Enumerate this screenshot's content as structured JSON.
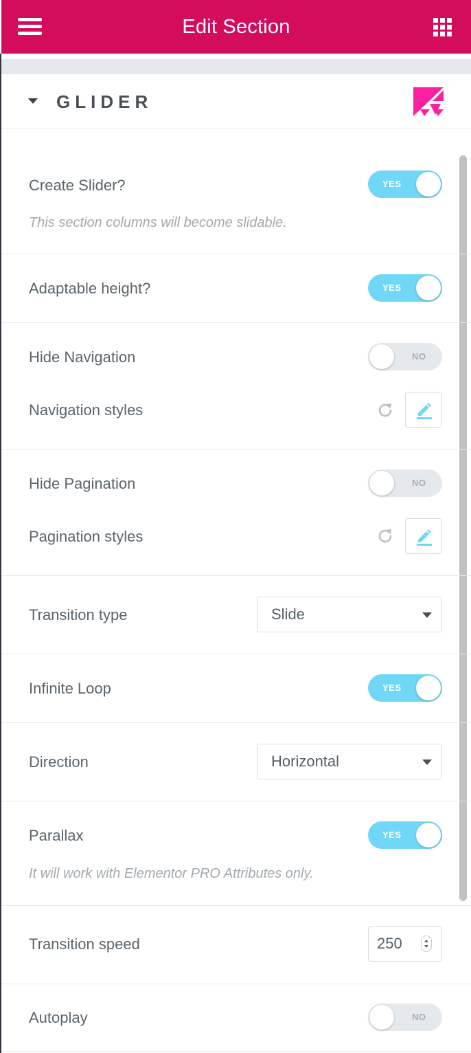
{
  "header": {
    "title": "Edit Section"
  },
  "section": {
    "title": "GLIDER"
  },
  "controls": {
    "create_slider": {
      "label": "Create Slider?",
      "state": "YES",
      "description": "This section columns will become slidable."
    },
    "adaptable_height": {
      "label": "Adaptable height?",
      "state": "YES"
    },
    "hide_navigation": {
      "label": "Hide Navigation",
      "state": "NO"
    },
    "navigation_styles": {
      "label": "Navigation styles"
    },
    "hide_pagination": {
      "label": "Hide Pagination",
      "state": "NO"
    },
    "pagination_styles": {
      "label": "Pagination styles"
    },
    "transition_type": {
      "label": "Transition type",
      "value": "Slide"
    },
    "infinite_loop": {
      "label": "Infinite Loop",
      "state": "YES"
    },
    "direction": {
      "label": "Direction",
      "value": "Horizontal"
    },
    "parallax": {
      "label": "Parallax",
      "state": "YES",
      "description": "It will work with Elementor PRO Attributes only."
    },
    "transition_speed": {
      "label": "Transition speed",
      "value": "250"
    },
    "autoplay": {
      "label": "Autoplay",
      "state": "NO"
    }
  },
  "colors": {
    "header_bg": "#d30c5c",
    "switch_on": "#71d7f7",
    "switch_off": "#e6e9ec",
    "logo": "#ff1fa5"
  },
  "icons": {
    "menu": "hamburger-icon",
    "apps": "grid-icon",
    "collapse": "caret-down-icon",
    "logo": "glider-logo-icon",
    "reset": "reset-icon",
    "edit": "pencil-icon"
  }
}
